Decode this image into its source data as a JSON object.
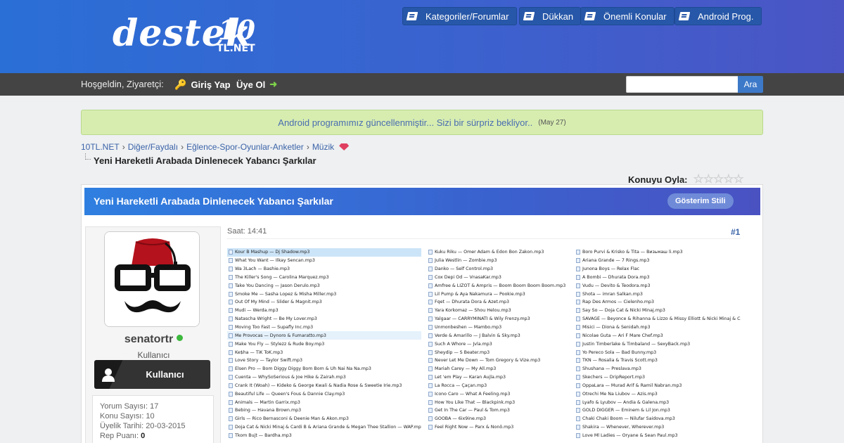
{
  "header": {
    "logo": {
      "word": "destek",
      "number": "10",
      "tld": "TL.NET"
    },
    "nav": [
      {
        "label": "Kategoriler/Forumlar",
        "icon": "book-icon"
      },
      {
        "label": "Dükkan",
        "icon": "book-icon"
      },
      {
        "label": "Önemli Konular",
        "icon": "book-icon"
      },
      {
        "label": "Android Prog.",
        "icon": "book-icon"
      }
    ]
  },
  "userbar": {
    "welcome": "Hoşgeldin, Ziyaretçi:",
    "login": "Giriş Yap",
    "register": "Üye Ol",
    "search_placeholder": "",
    "search_button": "Ara"
  },
  "notice": {
    "text": "Android programımız güncellenmiştir... Sizi bir sürpriz bekliyor..",
    "date": "(May 27)"
  },
  "breadcrumb": [
    "10TL.NET",
    "Diğer/Faydalı",
    "Eğlence-Spor-Oyunlar-Anketler",
    "Müzik"
  ],
  "breadcrumb_sep": "›",
  "page_title": "Yeni Hareketli Arabada Dinlenecek Yabancı Şarkılar",
  "rating": {
    "label": "Konuyu Oyla:",
    "stars": "☆☆☆☆☆"
  },
  "post": {
    "title": "Yeni Hareketli Arabada Dinlenecek Yabancı Şarkılar",
    "display_mode": "Gösterim Stili",
    "time": "Saat: 14:41",
    "number": "#1",
    "user": {
      "name": "senatortr",
      "title": "Kullanıcı",
      "rank": "Kullanıcı",
      "stats": {
        "posts": "Yorum Sayısı: 17",
        "topics": "Konu Sayısı: 10",
        "joined": "Üyelik Tarihi: 20-03-2015",
        "rep_label": "Rep Puanı:",
        "rep_value": "0"
      }
    },
    "files": {
      "col1": [
        "Kour B Mashup — Dj Shadow.mp3",
        "What You Want — Ilkay Sencan.mp3",
        "Wa 3Lach — Bashie.mp3",
        "The Killer's Song — Carolina Marquez.mp3",
        "Take You Dancing — Jason Derulo.mp3",
        "Smoke Me — Sasha Lopez & Misha Miller.mp3",
        "Out Of My Mind — Slider & Magnit.mp3",
        "Mudi — Werda.mp3",
        "Natascha Wright — Be My Lover.mp3",
        "Moving Too Fast — Supafly Inc.mp3",
        "Me Provocas — Dynoro & Fumaratto.mp3",
        "Make You Fly — Stylezz & Rude Boy.mp3",
        "Ke$ha — TiK ToK.mp3",
        "Love Story — Taylor Swift.mp3",
        "Elsen Pro — Bom Diggy Diggy Bom Bom & Uh Nai Na Na.mp3",
        "Cuenta — WhySoSerious & Joe Hike & Zairah.mp3",
        "Crank It (Woah) — Kideko & George Kwali & Nadia Rose & Sweetie Irie.mp3",
        "Beautiful Life — Queen's Fous & Dannie Clay.mp3",
        "Animals — Martin Garrix.mp3",
        "Bebing — Havana Brown.mp3",
        "Girls — Rico Bernasconi & Deenie Man & Akon.mp3",
        "Doja Cat & Nicki Minaj & Cardi B & Ariana Grande & Megan Thee Stallion — WAP.mp3",
        "Tkom Bujt — Bardha.mp3"
      ],
      "col2": [
        "Kuku Riku — Omer Adam & Edon Bon Zakon.mp3",
        "Julia Westlin — Zombie.mp3",
        "Danko — Self Control.mp3",
        "Cox Depi Od — VnasaKar.mp3",
        "Amfree & LIZOT & Ampris — Boom Boom Boom Boom.mp3",
        "Lil Pump & Aya Nakamura — Pookie.mp3",
        "Fqet — Dhurata Dora & Azet.mp3",
        "Yara Korkomaz — Shou Helou.mp3",
        "Yalgaar — CARRYMINATI & Wily Frenzy.mp3",
        "Unmonbeshen — Mambo.mp3",
        "Verde & Amarillo — J Balvin & Sky.mp3",
        "Such A Whore — Jvla.mp3",
        "Sheydip — S Beater.mp3",
        "Never Let Me Down — Tom Gregory & Vize.mp3",
        "Mariah Carey — My All.mp3",
        "Let 'em Play — Karan Aujla.mp3",
        "La Rocca — Çaçan.mp3",
        "Icono Caro — What A Feeling.mp3",
        "How You Like That — Blackpink.mp3",
        "Get In The Car — Paul & Tom.mp3",
        "GOOBA — 6ix9ine.mp3",
        "Feel Right Now — Parx & Nonô.mp3"
      ],
      "col3": [
        "Boro Purvi & Krisko & Tita — Визьмаш li.mp3",
        "Ariana Grande — 7 Rings.mp3",
        "Junona Boys — Relax Flac",
        "A Bombi — Dhurata Dora.mp3",
        "Vudu — Devito & Teodora.mp3",
        "Shota — imran Salkan.mp3",
        "Rap Des Armos — Cielenho.mp3",
        "Say So — Doja Cat & Nicki Minaj.mp3",
        "SAVAGE — Beyonce & Rihanna & Lizzo & Missy Elliott & Nicki Minaj & Card",
        "Misici — Diona & Senidah.mp3",
        "Nicolae Guta — Ari F Mare Chef.mp3",
        "Justin Timberlake & Timbaland — SexyBack.mp3",
        "Yo Pereco Sola — Bad Bunny.mp3",
        "TKN — Rosalia & Travis Scott.mp3",
        "Shushana — Preslava.mp3",
        "Skechers — DripReport.mp3",
        "OppaLara — Murad Arif & Ramil Nabran.mp3",
        "Otrechi Me Na Liubov — Azis.mp3",
        "Lyafo & Lyubov — Andia & Galena.mp3",
        "GOLD DIGGER — Eminem & Lil Jon.mp3",
        "Chaki Chaki Boom — Nilufar Saidova.mp3",
        "Shakira — Whenever, Wherever.mp3",
        "Love Ml Ladies — Oryane & Sean Paul.mp3"
      ]
    }
  },
  "colors": {
    "header": "#2a6fd6",
    "userbar": "#444444",
    "notice_bg": "#d7edb0",
    "link": "#3b63a8",
    "online": "#3cb83c"
  }
}
